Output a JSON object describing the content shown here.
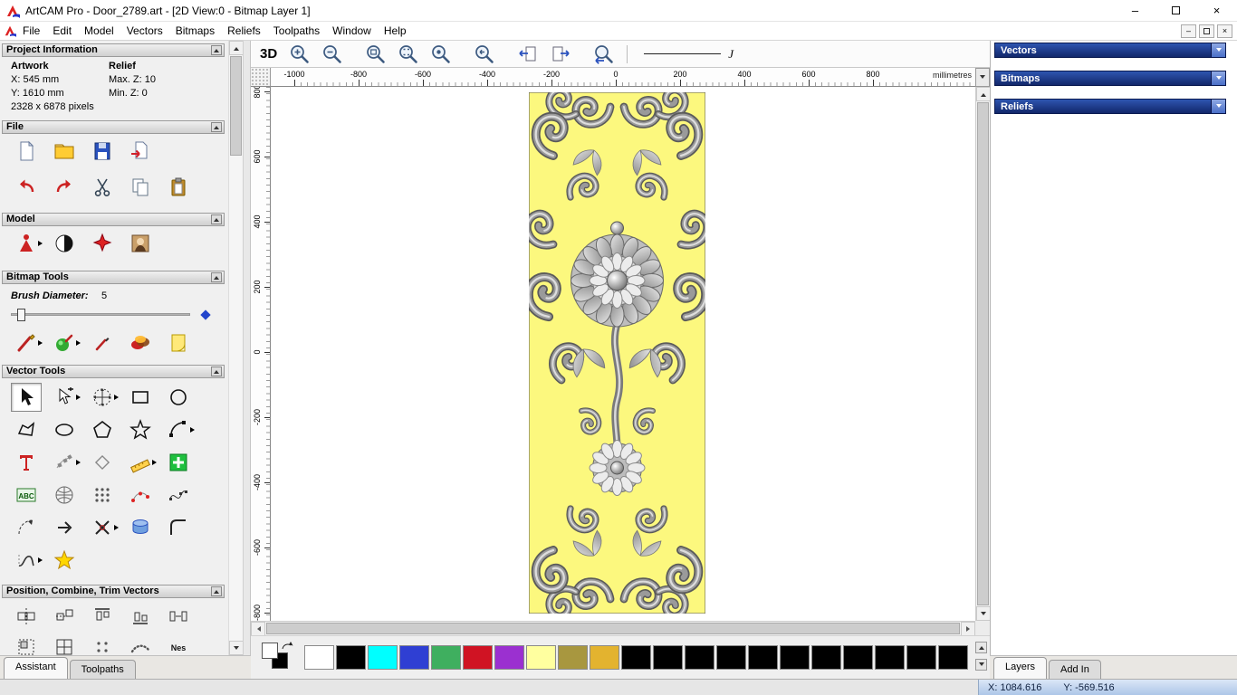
{
  "window": {
    "title": "ArtCAM Pro - Door_2789.art - [2D View:0 - Bitmap Layer 1]",
    "controls": {
      "minimize": "–",
      "close": "×"
    },
    "mdi_controls": {
      "minimize": "–",
      "close": "×"
    },
    "menu": [
      "File",
      "Edit",
      "Model",
      "Vectors",
      "Bitmaps",
      "Reliefs",
      "Toolpaths",
      "Window",
      "Help"
    ]
  },
  "left_panel": {
    "project": {
      "title": "Project Information",
      "artwork_heading": "Artwork",
      "relief_heading": "Relief",
      "artwork_lines": [
        "X: 545 mm",
        "Y: 1610 mm"
      ],
      "relief_lines": [
        "Max. Z: 10",
        "Min. Z: 0"
      ],
      "pixels": "2328 x 6878 pixels"
    },
    "file": {
      "title": "File",
      "row1": [
        {
          "n": "doc-new"
        },
        {
          "n": "folder-open"
        },
        {
          "n": "save"
        },
        {
          "n": "import"
        }
      ],
      "row2": [
        {
          "n": "undo"
        },
        {
          "n": "redo"
        },
        {
          "n": "cut"
        },
        {
          "n": "copy"
        },
        {
          "n": "paste"
        }
      ]
    },
    "model": {
      "title": "Model",
      "icons": [
        {
          "n": "model-size",
          "f": 1
        },
        {
          "n": "invert-bw"
        },
        {
          "n": "light-red"
        },
        {
          "n": "texture"
        }
      ]
    },
    "bitmap": {
      "title": "Bitmap Tools",
      "brush_label": "Brush Diameter:",
      "brush_value": "5",
      "icons": [
        {
          "n": "brush-red",
          "f": 1
        },
        {
          "n": "sphere-brush",
          "f": 1
        },
        {
          "n": "brush-small"
        },
        {
          "n": "palette-blob"
        },
        {
          "n": "page-flip"
        }
      ]
    },
    "vector": {
      "title": "Vector Tools",
      "icons": [
        {
          "n": "select-arrow",
          "a": 1
        },
        {
          "n": "node-edit",
          "f": 1
        },
        {
          "n": "transform",
          "f": 1
        },
        {
          "n": "rect-tool"
        },
        {
          "n": "circle-tool"
        },
        {
          "n": "polyline-tool"
        },
        {
          "n": "ellipse-tool"
        },
        {
          "n": "polygon-tool"
        },
        {
          "n": "star-tool"
        },
        {
          "n": "arc-tool",
          "f": 1
        },
        {
          "n": "text-tool"
        },
        {
          "n": "text-flow",
          "f": 1
        },
        {
          "n": "offset-shape"
        },
        {
          "n": "measure",
          "f": 1
        },
        {
          "n": "plus-green"
        },
        {
          "n": "abc-block"
        },
        {
          "n": "mesh-grid"
        },
        {
          "n": "dot-array"
        },
        {
          "n": "node-chain"
        },
        {
          "n": "curve-nodes"
        },
        {
          "n": "arc-dash"
        },
        {
          "n": "arrow-tool"
        },
        {
          "n": "trim-cut",
          "f": 1
        },
        {
          "n": "stack-3d"
        },
        {
          "n": "fillet"
        },
        {
          "n": "section-tool",
          "f": 1
        },
        {
          "n": "star-yellow"
        }
      ]
    },
    "position": {
      "title": "Position, Combine, Trim Vectors",
      "icons": [
        {
          "n": "align-center-h"
        },
        {
          "n": "align-center-v"
        },
        {
          "n": "align-top"
        },
        {
          "n": "align-bottom"
        },
        {
          "n": "align-sides"
        },
        {
          "n": "align-corner"
        },
        {
          "n": "align-grid"
        },
        {
          "n": "dot-array-sm"
        },
        {
          "n": "curve-dots"
        },
        {
          "n": "nest"
        }
      ]
    },
    "tabs": [
      {
        "label": "Assistant",
        "active": true
      },
      {
        "label": "Toolpaths",
        "active": false
      }
    ]
  },
  "canvas": {
    "toolbar": {
      "label_3d": "3D",
      "pen_label": "J",
      "icons": [
        {
          "n": "mag-plus"
        },
        {
          "n": "mag-minus"
        },
        {
          "n": "mag-page",
          "g": 1
        },
        {
          "n": "mag-fit"
        },
        {
          "n": "mag-obj"
        },
        {
          "n": "mag-prev",
          "g": 1
        },
        {
          "n": "doc-arrow-l",
          "g": 1
        },
        {
          "n": "doc-arrow-r"
        },
        {
          "n": "mag-arrow",
          "g": 1
        }
      ]
    },
    "rulers": {
      "units": "millimetres",
      "h": {
        "start": 26,
        "step": 71,
        "labels": [
          "-1000",
          "-800",
          "-600",
          "-400",
          "-200",
          "0",
          "200",
          "400",
          "600",
          "800"
        ]
      },
      "v": {
        "start": 5,
        "step": 72,
        "labels": [
          "800",
          "600",
          "400",
          "200",
          "0",
          "-200",
          "-400",
          "-600",
          "-800"
        ]
      }
    },
    "bitmap_bg": "#fcf87e"
  },
  "palette": {
    "front": "#ffffff",
    "back": "#000000",
    "swatches": [
      "#ffffff",
      "#000000",
      "#00ffff",
      "#2f3fd3",
      "#3faf5f",
      "#d01323",
      "#9b30d0",
      "#ffff9f",
      "#a8973f",
      "#e3b32f",
      "#000000",
      "#000000",
      "#000000",
      "#000000",
      "#000000",
      "#000000",
      "#000000",
      "#000000",
      "#000000",
      "#000000",
      "#000000"
    ]
  },
  "right_panel": {
    "sections": [
      "Vectors",
      "Bitmaps",
      "Reliefs"
    ],
    "tabs": [
      {
        "label": "Layers",
        "active": true
      },
      {
        "label": "Add In",
        "active": false
      }
    ]
  },
  "status": {
    "x": "X: 1084.616",
    "y": "Y: -569.516"
  },
  "colors": {
    "header_blue_top": "#2e55b0",
    "header_blue_bottom": "#12276b",
    "canvas_bitmap_bg": "#fcf87e"
  }
}
